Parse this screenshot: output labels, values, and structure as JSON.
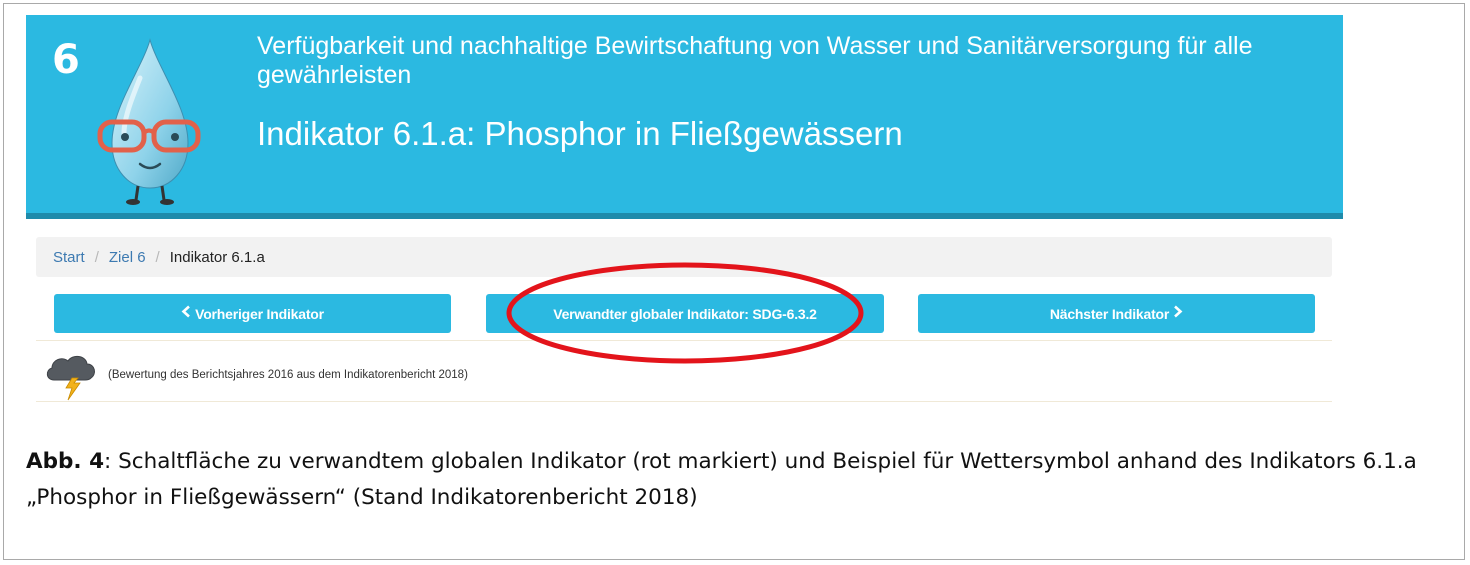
{
  "header": {
    "goal_number": "6",
    "goal_title": "Verfügbarkeit und nachhaltige Bewirtschaftung von Wasser und Sanitärversorgung für alle gewährleisten",
    "indicator_title": "Indikator 6.1.a: Phosphor in Fließgewässern",
    "banner_color": "#2bb9e1",
    "mascot_icon": "water-drop-mascot-with-glasses"
  },
  "breadcrumb": {
    "items": [
      {
        "label": "Start"
      },
      {
        "label": "Ziel 6"
      }
    ],
    "separator": "/",
    "current": "Indikator 6.1.a"
  },
  "nav_buttons": {
    "prev": "Vorheriger Indikator",
    "related": "Verwandter globaler Indikator: SDG-6.3.2",
    "next": "Nächster Indikator",
    "accent_color": "#2bb9e1"
  },
  "highlight": {
    "color": "#e3141b"
  },
  "assessment": {
    "icon": "thunderstorm-cloud-icon",
    "note": "(Bewertung des Berichtsjahres 2016 aus dem Indikatorenbericht 2018)"
  },
  "caption": {
    "label": "Abb. 4",
    "text": ": Schaltfläche zu verwandtem globalen Indikator (rot markiert) und Beispiel für Wettersymbol anhand des Indikators 6.1.a „Phosphor in Fließgewässern“ (Stand Indikatorenbericht 2018)"
  }
}
